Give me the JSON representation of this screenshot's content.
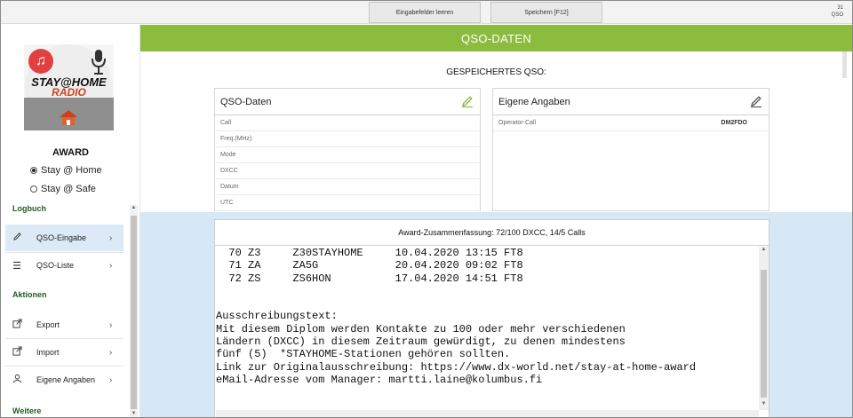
{
  "topbar": {
    "clear_label": "Eingabefelder leeren",
    "save_label": "Speichern [F12]",
    "counter_value": "31",
    "counter_label": "QSO"
  },
  "sidebar": {
    "logo_text_line1": "STAY@HOME",
    "logo_text_line2": "RADIO",
    "award_title": "AWARD",
    "radio_options": [
      {
        "label": "Stay @ Home",
        "selected": true
      },
      {
        "label": "Stay @ Safe",
        "selected": false
      }
    ],
    "sections": {
      "logbuch": "Logbuch",
      "aktionen": "Aktionen",
      "weitere": "Weitere"
    },
    "items": [
      {
        "label": "QSO-Eingabe",
        "icon": "pencil-icon",
        "active": true
      },
      {
        "label": "QSO-Liste",
        "icon": "list-icon",
        "active": false
      },
      {
        "label": "Export",
        "icon": "export-icon",
        "active": false
      },
      {
        "label": "Import",
        "icon": "import-icon",
        "active": false
      },
      {
        "label": "Eigene Angaben",
        "icon": "user-icon",
        "active": false
      }
    ]
  },
  "main": {
    "header_title": "QSO-DATEN",
    "saved_title": "GESPEICHERTES QSO:",
    "qso_card": {
      "title": "QSO-Daten",
      "fields": [
        "Call",
        "Freq.(MHz)",
        "Mode",
        "DXCC",
        "Datum",
        "UTC"
      ]
    },
    "own_card": {
      "title": "Eigene Angaben",
      "fields": [
        {
          "label": "Operator-Call",
          "value": "DM2FDO"
        }
      ]
    },
    "award": {
      "summary": "Award-Zusammenfassung: 72/100 DXCC, 14/5 Calls",
      "log_lines": [
        "  70 Z3     Z30STAYHOME     10.04.2020 13:15 FT8",
        "  71 ZA     ZA5G            20.04.2020 09:02 FT8",
        "  72 ZS     ZS6HON          17.04.2020 14:51 FT8",
        "",
        "",
        "Ausschreibungstext:",
        "Mit diesem Diplom werden Kontakte zu 100 oder mehr verschiedenen",
        "Ländern (DXCC) in diesem Zeitraum gewürdigt, zu denen mindestens",
        "fünf (5)  *STAYHOME-Stationen gehören sollten.",
        "Link zur Originalausschreibung: https://www.dx-world.net/stay-at-home-award",
        "eMail-Adresse vom Manager: martti.laine@kolumbus.fi"
      ]
    }
  },
  "colors": {
    "accent_green": "#8cbc3e",
    "panel_blue": "#d6e8f6",
    "active_nav": "#dceaf7",
    "section_green": "#1f5c1f"
  }
}
